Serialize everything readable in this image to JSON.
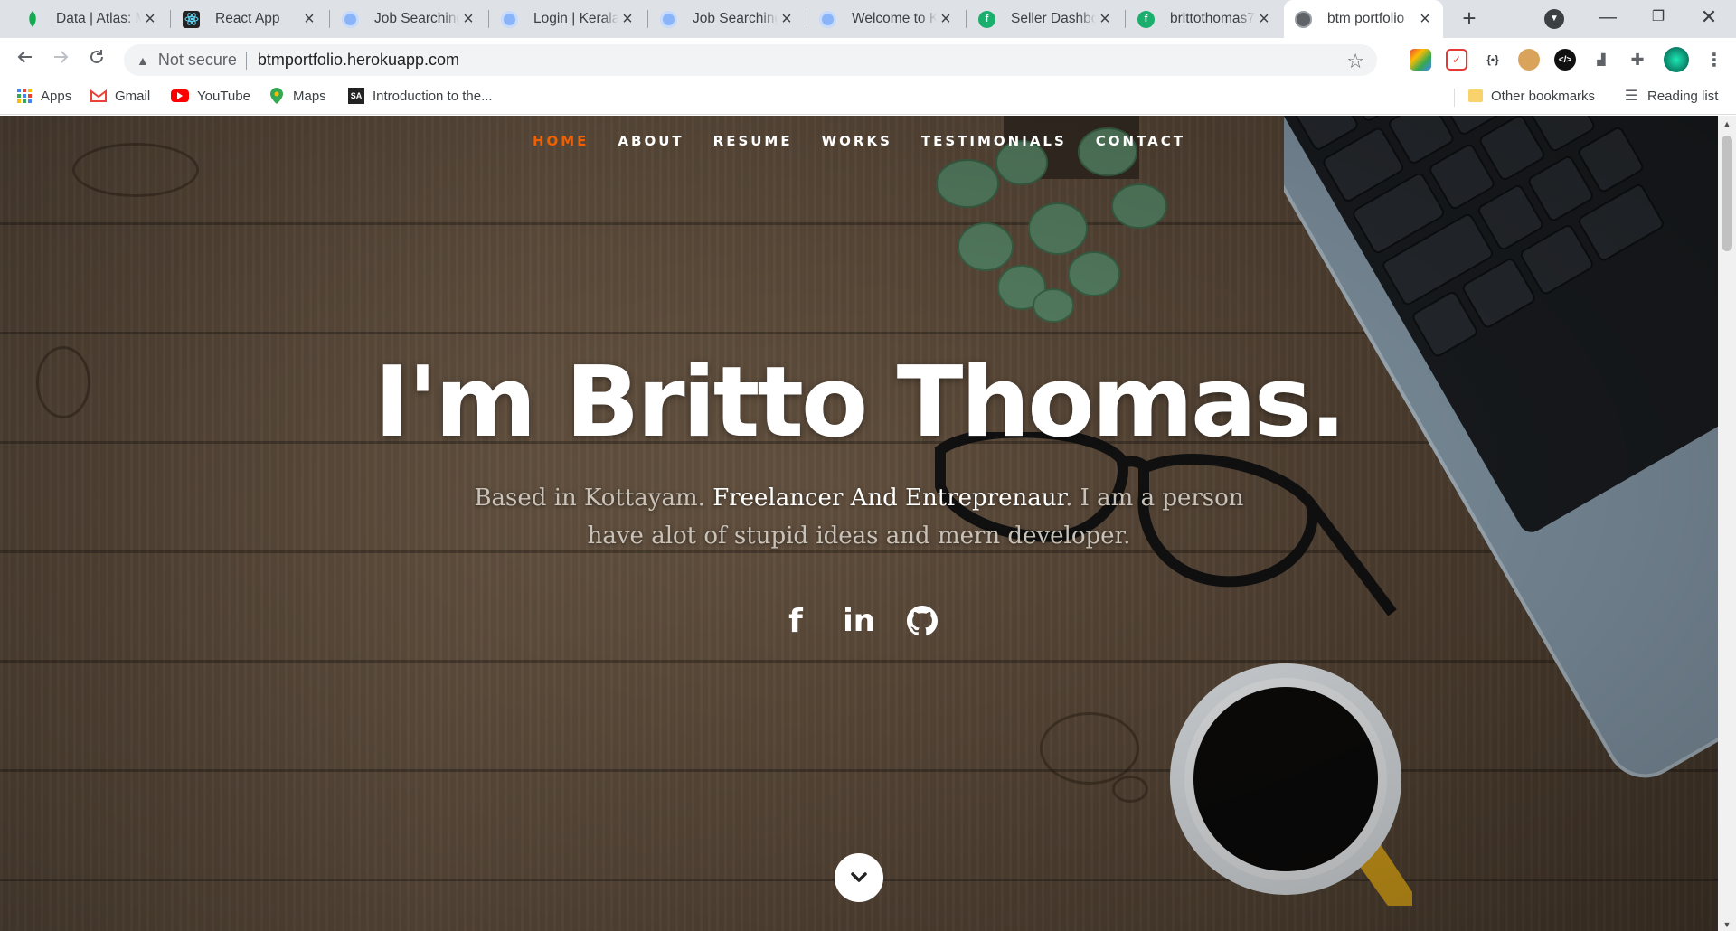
{
  "browser": {
    "tabs": [
      {
        "title": "Data | Atlas: M",
        "favicon": "leaf-icon",
        "color": "#13aa52",
        "active": false
      },
      {
        "title": "React App",
        "favicon": "react-icon",
        "color": "#222222",
        "active": false
      },
      {
        "title": "Job Searching",
        "favicon": "globe-icon",
        "color": "#8ab4f8",
        "active": false
      },
      {
        "title": "Login | Kerala",
        "favicon": "globe-icon",
        "color": "#8ab4f8",
        "active": false
      },
      {
        "title": "Job Searching",
        "favicon": "globe-icon",
        "color": "#8ab4f8",
        "active": false
      },
      {
        "title": "Welcome to K",
        "favicon": "globe-icon",
        "color": "#8ab4f8",
        "active": false
      },
      {
        "title": "Seller Dashbo",
        "favicon": "freshworks-icon",
        "color": "#1aaf6c",
        "active": false
      },
      {
        "title": "brittothomas7",
        "favicon": "freshworks-icon",
        "color": "#1aaf6c",
        "active": false
      },
      {
        "title": "btm portfolio",
        "favicon": "globe-icon",
        "color": "#5f6368",
        "active": true
      }
    ],
    "security_label": "Not secure",
    "url": "btmportfolio.herokuapp.com",
    "bookmarks": [
      {
        "label": "Apps",
        "icon": "apps-grid-icon"
      },
      {
        "label": "Gmail",
        "icon": "gmail-icon"
      },
      {
        "label": "YouTube",
        "icon": "youtube-icon"
      },
      {
        "label": "Maps",
        "icon": "maps-pin-icon"
      },
      {
        "label": "Introduction to the...",
        "icon": "sa-icon"
      }
    ],
    "other_bookmarks": "Other bookmarks",
    "reading_list": "Reading list"
  },
  "site": {
    "nav": [
      "HOME",
      "ABOUT",
      "RESUME",
      "WORKS",
      "TESTIMONIALS",
      "CONTACT"
    ],
    "current_nav": "HOME",
    "accent_color": "#f06000",
    "headline": "I'm Britto Thomas.",
    "intro_before": "Based in Kottayam. ",
    "intro_highlight": "Freelancer And Entreprenaur",
    "intro_after": ". I am a person have alot of stupid ideas and mern developer.",
    "social": [
      {
        "label": "f",
        "icon": "facebook-icon"
      },
      {
        "label": "in",
        "icon": "linkedin-icon"
      },
      {
        "label": "",
        "icon": "github-icon"
      }
    ],
    "scroll_icon": "chevron-down-icon"
  }
}
